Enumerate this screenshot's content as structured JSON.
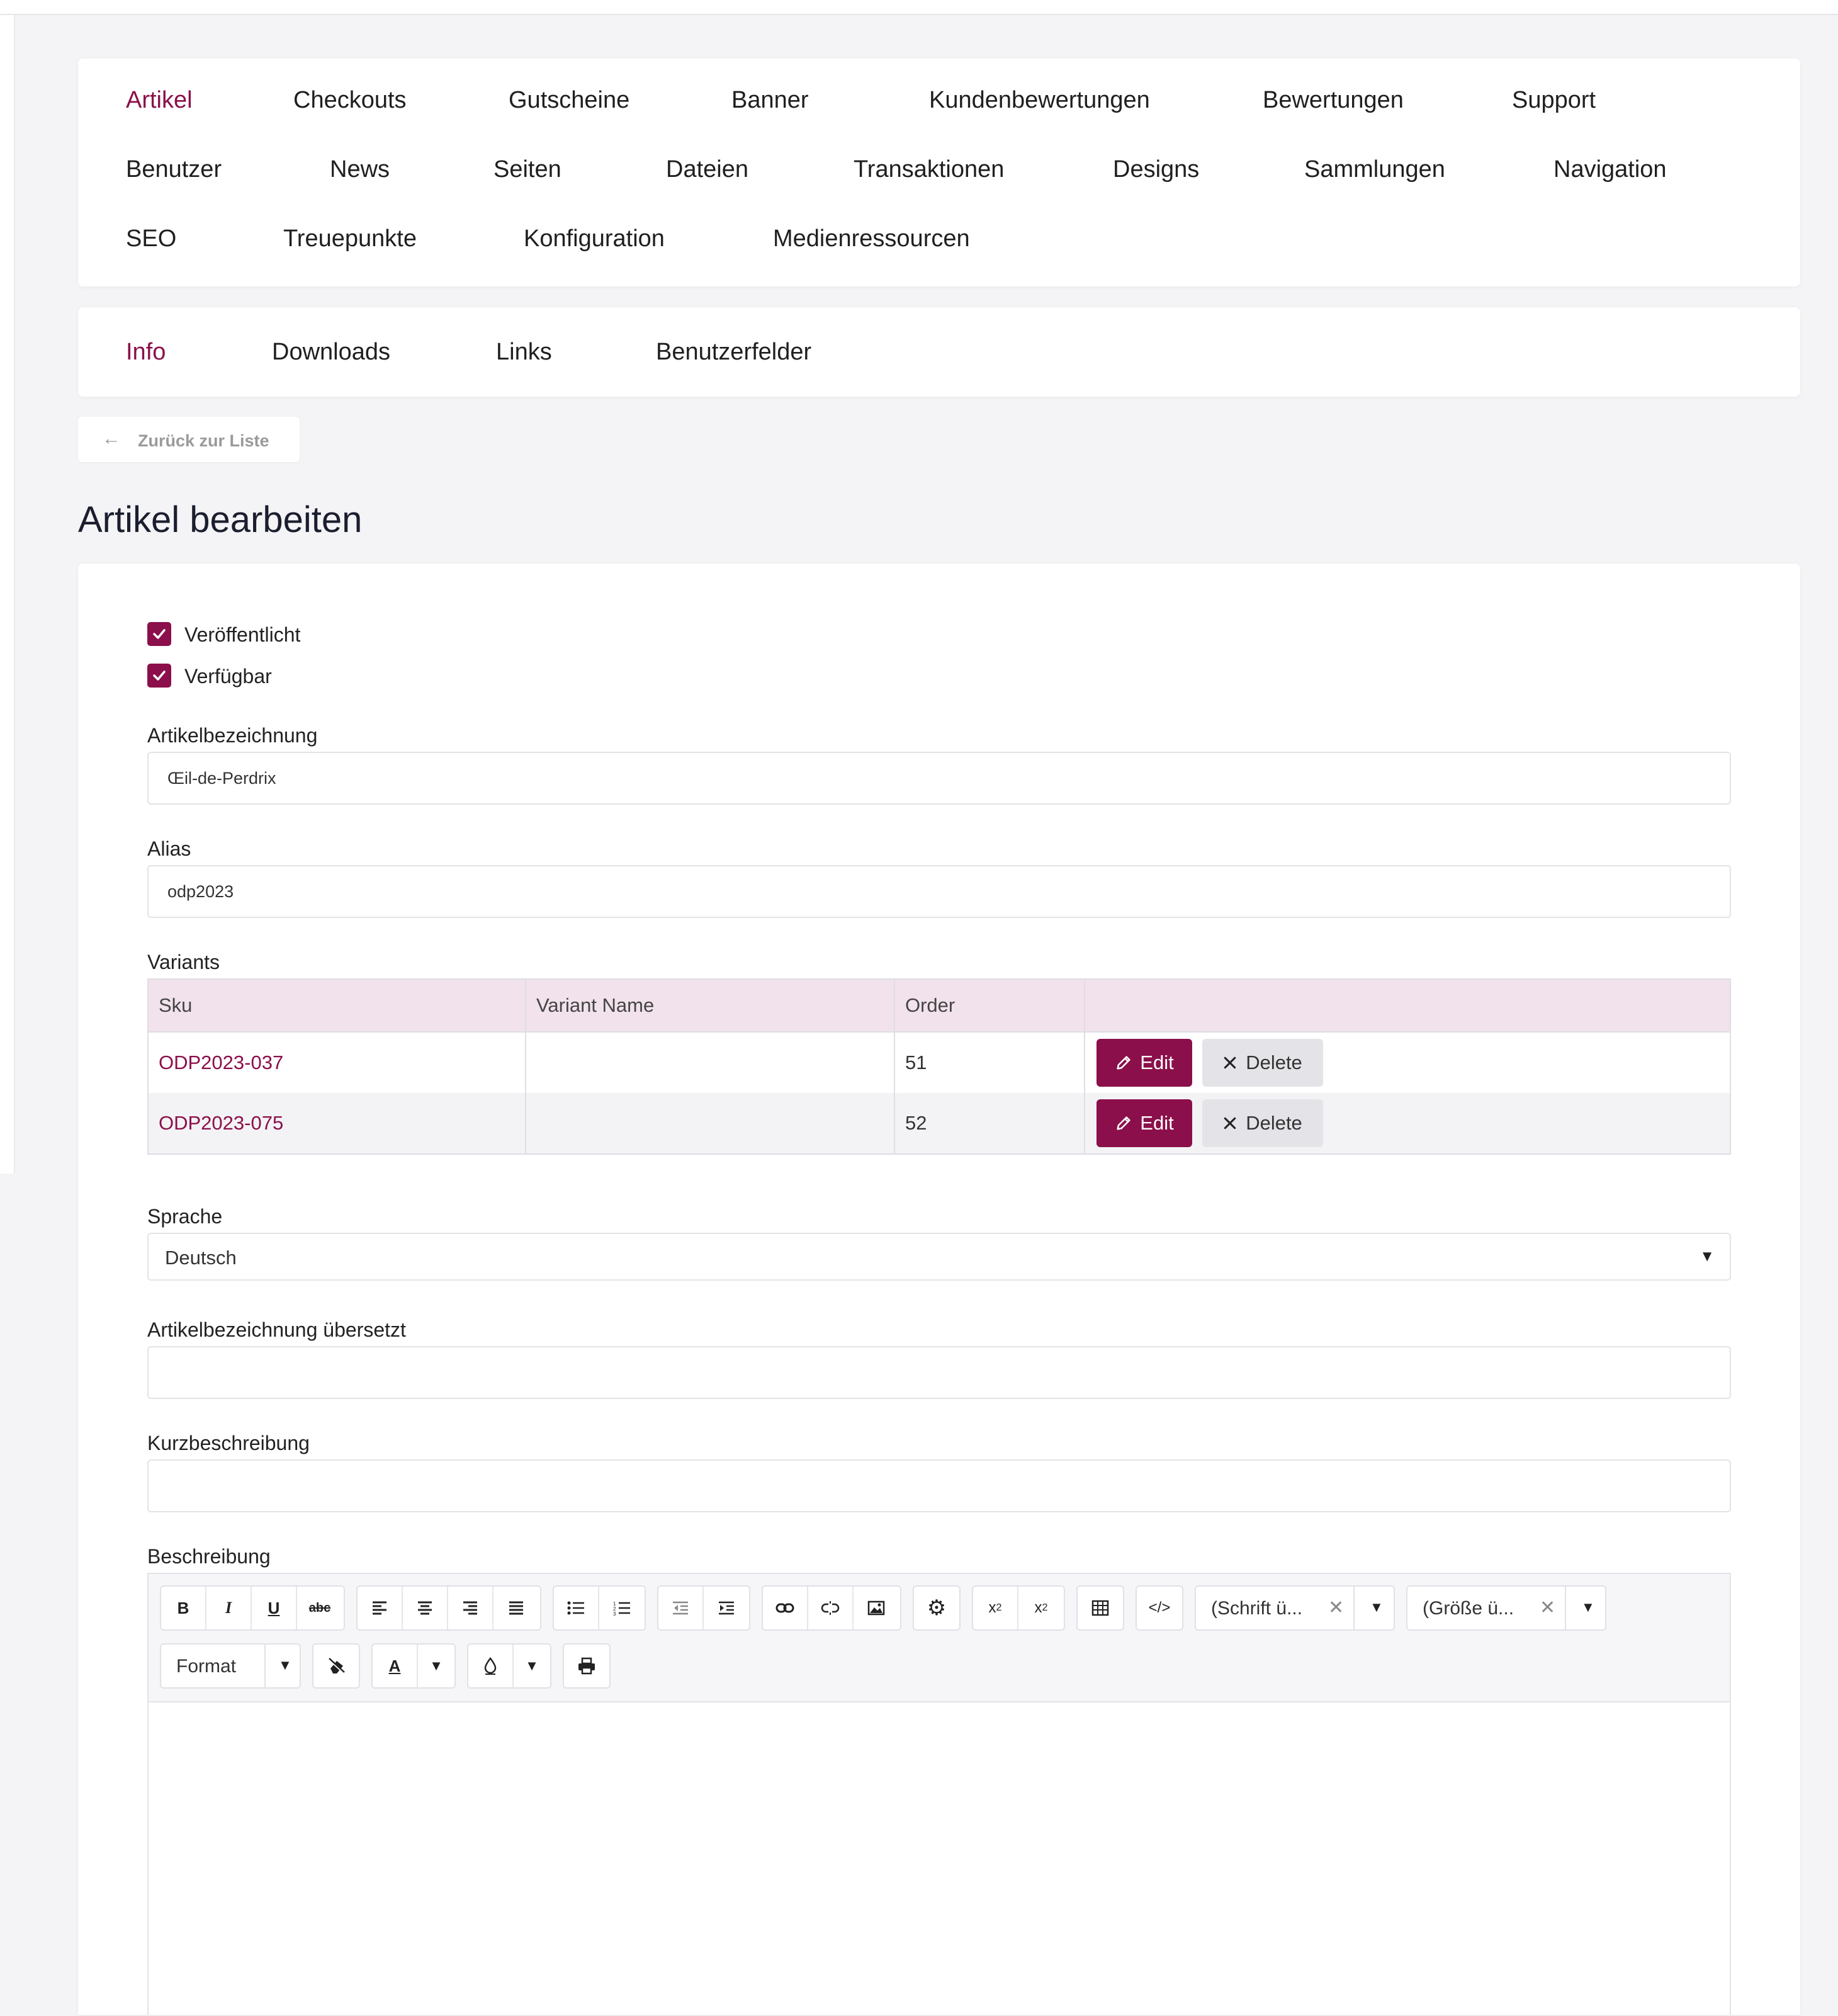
{
  "nav": {
    "row1": [
      "Artikel",
      "Checkouts",
      "Gutscheine",
      "Banner",
      "Kundenbewertungen",
      "Bewertungen",
      "Support"
    ],
    "row2": [
      "Benutzer",
      "News",
      "Seiten",
      "Dateien",
      "Transaktionen",
      "Designs",
      "Sammlungen",
      "Navigation"
    ],
    "row3": [
      "SEO",
      "Treuepunkte",
      "Konfiguration",
      "Medienressourcen"
    ],
    "active": "Artikel"
  },
  "subnav": {
    "items": [
      "Info",
      "Downloads",
      "Links",
      "Benutzerfelder"
    ],
    "active": "Info"
  },
  "back_label": "Zurück zur Liste",
  "page_title": "Artikel bearbeiten",
  "form": {
    "published_label": "Veröffentlicht",
    "available_label": "Verfügbar",
    "name_label": "Artikelbezeichnung",
    "name_value": "Œil-de-Perdrix",
    "alias_label": "Alias",
    "alias_value": "odp2023",
    "variants_label": "Variants",
    "variants": {
      "headers": [
        "Sku",
        "Variant Name",
        "Order",
        ""
      ],
      "rows": [
        {
          "sku": "ODP2023-037",
          "name": "",
          "order": "51"
        },
        {
          "sku": "ODP2023-075",
          "name": "",
          "order": "52"
        }
      ],
      "edit_label": "Edit",
      "delete_label": "Delete"
    },
    "language_label": "Sprache",
    "language_value": "Deutsch",
    "translated_name_label": "Artikelbezeichnung übersetzt",
    "translated_name_value": "",
    "short_desc_label": "Kurzbeschreibung",
    "short_desc_value": "",
    "desc_label": "Beschreibung"
  },
  "editor": {
    "font_combo": "(Schrift ü...",
    "size_combo": "(Größe ü...",
    "format_combo": "Format"
  },
  "colors": {
    "accent": "#8b0f4a",
    "header_bg": "#f2e2ec"
  }
}
